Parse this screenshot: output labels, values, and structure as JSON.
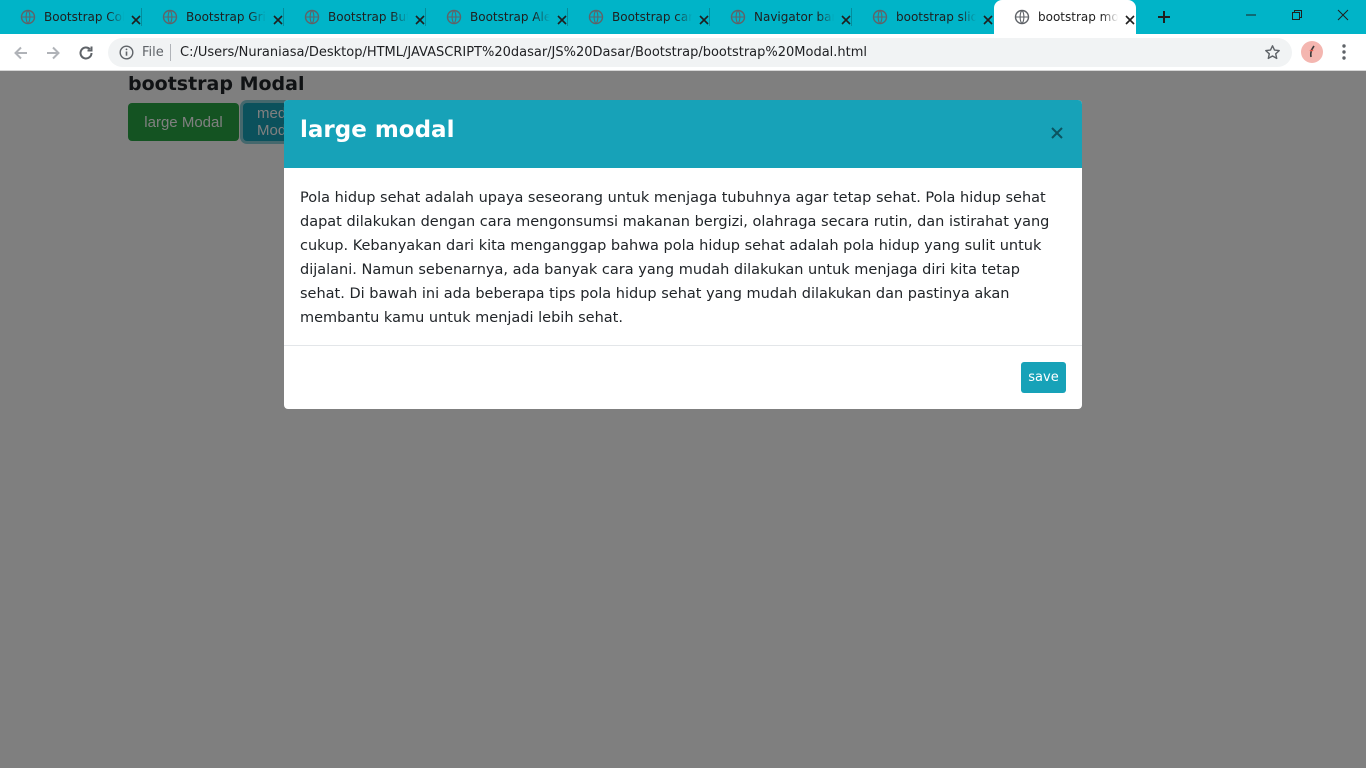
{
  "browser": {
    "tabs": [
      {
        "title": "Bootstrap Colors",
        "active": false
      },
      {
        "title": "Bootstrap Grid",
        "active": false
      },
      {
        "title": "Bootstrap Buttons",
        "active": false
      },
      {
        "title": "Bootstrap Alerts",
        "active": false
      },
      {
        "title": "Bootstrap card",
        "active": false
      },
      {
        "title": "Navigator bar",
        "active": false
      },
      {
        "title": "bootstrap slider",
        "active": false
      },
      {
        "title": "bootstrap modal",
        "active": true
      }
    ],
    "address": {
      "scheme_label": "File",
      "url": "C:/Users/Nuraniasa/Desktop/HTML/JAVASCRIPT%20dasar/JS%20Dasar/Bootstrap/bootstrap%20Modal.html"
    },
    "colors": {
      "tabstrip": "#00b4c8",
      "toolbar": "#ffffff"
    }
  },
  "page": {
    "heading": "bootstrap Modal",
    "buttons": {
      "large": "large Modal",
      "medium": "medium Modal"
    },
    "colors": {
      "success": "#28a745",
      "info": "#17a2b8"
    }
  },
  "modal": {
    "title": "large modal",
    "close_glyph": "×",
    "body": "Pola hidup sehat adalah upaya seseorang untuk menjaga tubuhnya agar tetap sehat. Pola hidup sehat dapat dilakukan dengan cara mengonsumsi makanan bergizi, olahraga secara rutin, dan istirahat yang cukup. Kebanyakan dari kita menganggap bahwa pola hidup sehat adalah pola hidup yang sulit untuk dijalani. Namun sebenarnya, ada banyak cara yang mudah dilakukan untuk menjaga diri kita tetap sehat. Di bawah ini ada beberapa tips pola hidup sehat yang mudah dilakukan dan pastinya akan membantu kamu untuk menjadi lebih sehat.",
    "save_label": "save"
  }
}
